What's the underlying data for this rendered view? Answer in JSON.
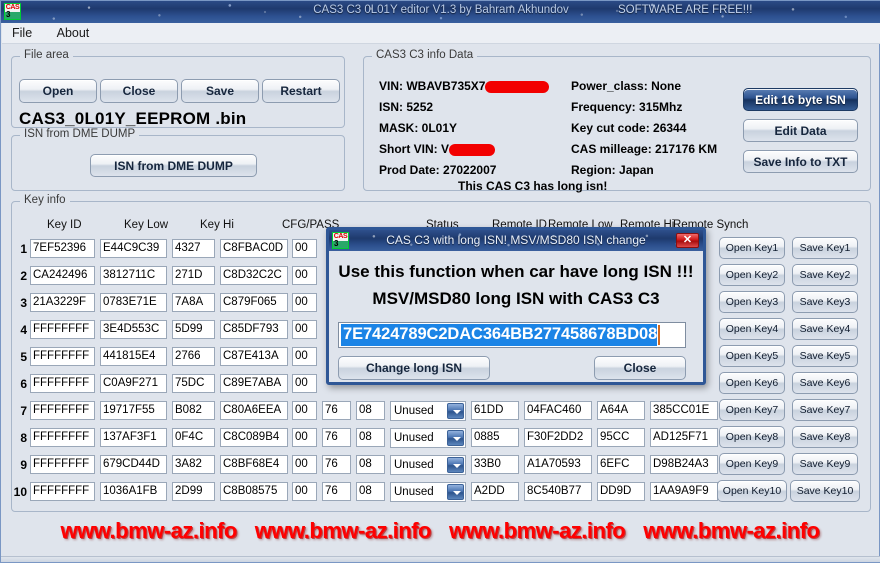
{
  "window": {
    "title": "CAS3 C3 0L01Y editor V1.3 by Bahram Akhundov",
    "free_notice": "SOFTWARE ARE FREE!!!",
    "icon": "cas3-app-icon"
  },
  "menu": {
    "items": [
      "File",
      "About"
    ]
  },
  "file_area": {
    "legend": "File area",
    "buttons": [
      "Open",
      "Close",
      "Save",
      "Restart"
    ],
    "filename": "CAS3_0L01Y_EEPROM .bin"
  },
  "isn_dme": {
    "legend": "ISN from DME DUMP",
    "button": "ISN from DME DUMP"
  },
  "info": {
    "legend": "CAS3 C3 info Data",
    "left": [
      {
        "label": "VIN:",
        "value": "WBAVB735X7",
        "redacted": true,
        "redact_width": 68
      },
      {
        "label": "ISN:",
        "value": "5252",
        "redacted": false
      },
      {
        "label": "MASK:",
        "value": "0L01Y",
        "redacted": false
      },
      {
        "label": "Short VIN:",
        "value": "V",
        "redacted": true,
        "redact_width": 48
      },
      {
        "label": "Prod Date:",
        "value": "27022007",
        "redacted": false
      }
    ],
    "right": [
      {
        "label": "Power_class:",
        "value": "None"
      },
      {
        "label": "Frequency:",
        "value": "315Mhz"
      },
      {
        "label": "Key cut code:",
        "value": "26344"
      },
      {
        "label": "CAS milleage:",
        "value": "217176 KM"
      },
      {
        "label": "Region:",
        "value": "Japan"
      }
    ],
    "note": "This CAS C3 has long isn!",
    "buttons": {
      "edit16": "Edit 16 byte ISN",
      "edit_data": "Edit Data",
      "save_txt": "Save Info to TXT"
    }
  },
  "key_info": {
    "legend": "Key info",
    "headers": {
      "key_id": "Key ID",
      "key_low": "Key Low",
      "key_hi": "Key Hi",
      "cfg_pass": "CFG/PASS",
      "status": "Status",
      "remote_id": "Remote ID",
      "remote_low": "Remote Low",
      "remote_hi": "Remote Hi",
      "remote_synch": "Remote Synch"
    },
    "rows": [
      {
        "n": "1",
        "key_id": "7EF52396",
        "key_low": "E44C9C39",
        "key_hi": "4327",
        "cfg": "C8FBAC0D",
        "pass": "00",
        "s1": "",
        "s2": "",
        "status": "",
        "remote_id": "",
        "remote_low": "",
        "remote_hi": "",
        "remote_synch": "",
        "open": "Open Key1",
        "save": "Save Key1"
      },
      {
        "n": "2",
        "key_id": "CA242496",
        "key_low": "3812711C",
        "key_hi": "271D",
        "cfg": "C8D32C2C",
        "pass": "00",
        "s1": "",
        "s2": "",
        "status": "",
        "remote_id": "",
        "remote_low": "",
        "remote_hi": "",
        "remote_synch": "",
        "open": "Open Key2",
        "save": "Save Key2"
      },
      {
        "n": "3",
        "key_id": "21A3229F",
        "key_low": "0783E71E",
        "key_hi": "7A8A",
        "cfg": "C879F065",
        "pass": "00",
        "s1": "",
        "s2": "",
        "status": "",
        "remote_id": "",
        "remote_low": "",
        "remote_hi": "",
        "remote_synch": "",
        "open": "Open Key3",
        "save": "Save Key3"
      },
      {
        "n": "4",
        "key_id": "FFFFFFFF",
        "key_low": "3E4D553C",
        "key_hi": "5D99",
        "cfg": "C85DF793",
        "pass": "00",
        "s1": "",
        "s2": "",
        "status": "",
        "remote_id": "",
        "remote_low": "",
        "remote_hi": "",
        "remote_synch": "",
        "open": "Open Key4",
        "save": "Save Key4"
      },
      {
        "n": "5",
        "key_id": "FFFFFFFF",
        "key_low": "441815E4",
        "key_hi": "2766",
        "cfg": "C87E413A",
        "pass": "00",
        "s1": "",
        "s2": "",
        "status": "",
        "remote_id": "",
        "remote_low": "",
        "remote_hi": "",
        "remote_synch": "",
        "open": "Open Key5",
        "save": "Save Key5"
      },
      {
        "n": "6",
        "key_id": "FFFFFFFF",
        "key_low": "C0A9F271",
        "key_hi": "75DC",
        "cfg": "C89E7ABA",
        "pass": "00",
        "s1": "",
        "s2": "",
        "status": "",
        "remote_id": "",
        "remote_low": "",
        "remote_hi": "",
        "remote_synch": "",
        "open": "Open Key6",
        "save": "Save Key6"
      },
      {
        "n": "7",
        "key_id": "FFFFFFFF",
        "key_low": "19717F55",
        "key_hi": "B082",
        "cfg": "C80A6EEA",
        "pass": "00",
        "s1": "76",
        "s2": "08",
        "status": "Unused",
        "remote_id": "61DD",
        "remote_low": "04FAC460",
        "remote_hi": "A64A",
        "remote_synch": "385CC01E",
        "open": "Open Key7",
        "save": "Save Key7"
      },
      {
        "n": "8",
        "key_id": "FFFFFFFF",
        "key_low": "137AF3F1",
        "key_hi": "0F4C",
        "cfg": "C8C089B4",
        "pass": "00",
        "s1": "76",
        "s2": "08",
        "status": "Unused",
        "remote_id": "0885",
        "remote_low": "F30F2DD2",
        "remote_hi": "95CC",
        "remote_synch": "AD125F71",
        "open": "Open Key8",
        "save": "Save Key8"
      },
      {
        "n": "9",
        "key_id": "FFFFFFFF",
        "key_low": "679CD44D",
        "key_hi": "3A82",
        "cfg": "C8BF68E4",
        "pass": "00",
        "s1": "76",
        "s2": "08",
        "status": "Unused",
        "remote_id": "33B0",
        "remote_low": "A1A70593",
        "remote_hi": "6EFC",
        "remote_synch": "D98B24A3",
        "open": "Open Key9",
        "save": "Save Key9"
      },
      {
        "n": "10",
        "key_id": "FFFFFFFF",
        "key_low": "1036A1FB",
        "key_hi": "2D99",
        "cfg": "C8B08575",
        "pass": "00",
        "s1": "76",
        "s2": "08",
        "status": "Unused",
        "remote_id": "A2DD",
        "remote_low": "8C540B77",
        "remote_hi": "DD9D",
        "remote_synch": "1AA9A9F9",
        "open": "Open Key10",
        "save": "Save Key10"
      }
    ],
    "status_options": [
      "Unused"
    ]
  },
  "dialog": {
    "title": "CAS C3 with long ISN! MSV/MSD80 ISN change",
    "close_glyph": "✕",
    "line1": "Use this function when car have long ISN !!!",
    "line2": "MSV/MSD80 long ISN with CAS3 C3",
    "isn_value": "7E7424789C2DAC364BB277458678BD08",
    "change_button": "Change long ISN",
    "close_button": "Close"
  },
  "watermark": {
    "text": "www.bmw-az.info",
    "repeat": 4
  },
  "colors": {
    "titlebar": "#1f3a6e",
    "accent_blue": "#2e5490",
    "selection": "#1b84e6",
    "watermark_red": "#ff0000",
    "redaction_red": "#f20000",
    "dialog_border": "#2f5796"
  }
}
